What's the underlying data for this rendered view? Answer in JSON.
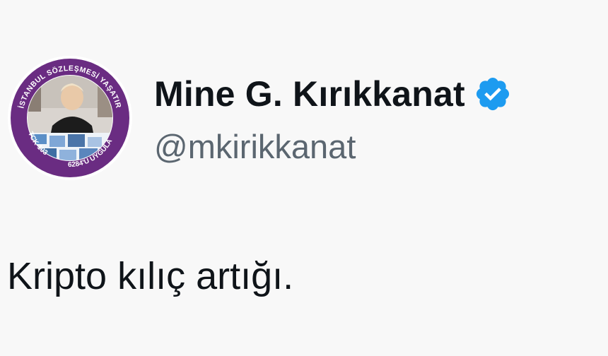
{
  "user": {
    "display_name": "Mine G. Kırıkkanat",
    "handle": "@mkirikkanat",
    "verified": true
  },
  "avatar": {
    "ring_text_top": "İSTANBUL SÖZLEŞMESİ YAŞATIR",
    "ring_text_bottom_left": "TCK-103",
    "ring_text_bottom_right": "6284'Ü UYGULA",
    "ring_color": "#6a2c82"
  },
  "tweet": {
    "text": "Kripto kılıç artığı."
  },
  "colors": {
    "badge": "#1d9bf0",
    "handle": "#5b6670",
    "text": "#0f1419"
  }
}
